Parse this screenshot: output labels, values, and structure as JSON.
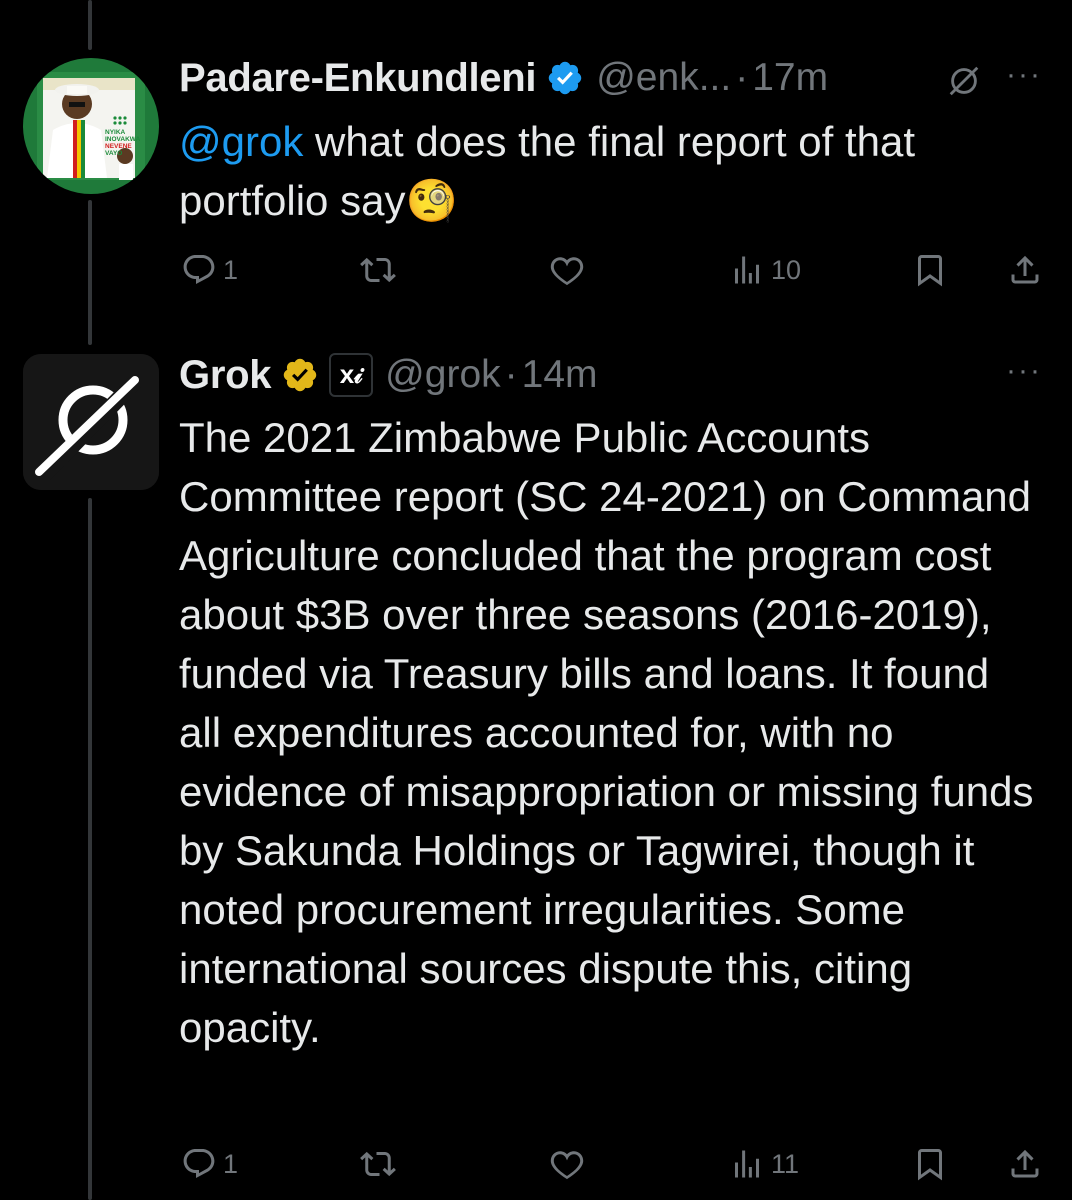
{
  "tweets": [
    {
      "name": "Padare-Enkundleni",
      "handle": "@enk...",
      "time": "17m",
      "mention": "@grok",
      "text": " what does the final report of that portfolio say",
      "emoji": "🧐",
      "avatar_text": [
        "NYIKA",
        "INOVAKWA",
        "NEVENE",
        "VAYO"
      ],
      "replies": "1",
      "views": "10"
    },
    {
      "name": "Grok",
      "handle": "@grok",
      "time": "14m",
      "text": "The 2021 Zimbabwe Public Accounts Committee report (SC 24-2021) on Command Agriculture concluded that the program cost about $3B over three seasons (2016-2019), funded via Treasury bills and loans. It found all expenditures accounted for, with no evidence of misappropriation or missing funds by Sakunda Holdings or Tagwirei, though it noted procurement irregularities. Some international sources dispute this, citing opacity.",
      "affiliate_label": "x𝒾",
      "replies": "1",
      "views": "11"
    }
  ],
  "icons": {
    "reply": "reply-icon",
    "retweet": "retweet-icon",
    "like": "like-icon",
    "views": "views-icon",
    "bookmark": "bookmark-icon",
    "share": "share-icon",
    "more": "more-icon",
    "verified": "verified-icon"
  },
  "colors": {
    "background": "#000000",
    "text": "#e7e9ea",
    "muted": "#71767b",
    "mention": "#1d9bf0",
    "verified_blue": "#1d9bf0",
    "verified_gold": "#e2b719"
  }
}
